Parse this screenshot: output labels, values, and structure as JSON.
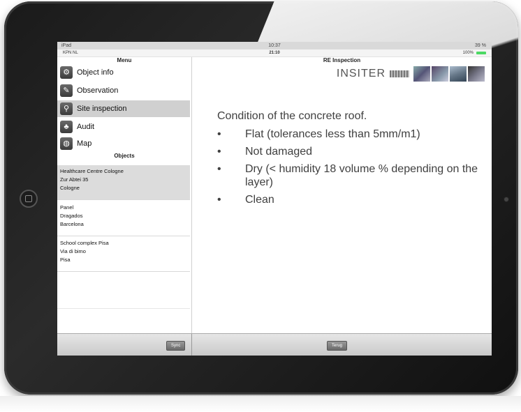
{
  "device": {
    "model_label": "iPad",
    "time": "10:37",
    "battery": "39 %"
  },
  "app_status": {
    "carrier": "KPN NL",
    "time": "21:10",
    "battery": "100%"
  },
  "sidebar": {
    "menu_title": "Menu",
    "items": [
      {
        "label": "Object info",
        "icon": "object-info-icon",
        "selected": false
      },
      {
        "label": "Observation",
        "icon": "pencil-icon",
        "selected": false
      },
      {
        "label": "Site inspection",
        "icon": "magnifier-icon",
        "selected": true
      },
      {
        "label": "Audit",
        "icon": "audit-icon",
        "selected": false
      },
      {
        "label": "Map",
        "icon": "globe-icon",
        "selected": false
      }
    ],
    "objects_title": "Objects",
    "objects": [
      {
        "lines": [
          "Healthcare Centre Cologne",
          "Zur Abtei 35",
          "Cologne"
        ],
        "selected": true
      },
      {
        "lines": [
          "Panel",
          "Dragados",
          "Barcelona"
        ],
        "selected": false
      },
      {
        "lines": [
          "School complex Pisa",
          "Via di bimo",
          "Pisa"
        ],
        "selected": false
      }
    ]
  },
  "main": {
    "title": "RE Inspection",
    "logo_text": "INSITER",
    "content_title": "Condition of the concrete roof.",
    "bullets": [
      "Flat (tolerances less than 5mm/m1)",
      "Not damaged",
      "Dry (< humidity 18 volume % depending on the layer)",
      "Clean"
    ]
  },
  "toolbar": {
    "sync_label": "Sync",
    "back_label": "Terug"
  }
}
